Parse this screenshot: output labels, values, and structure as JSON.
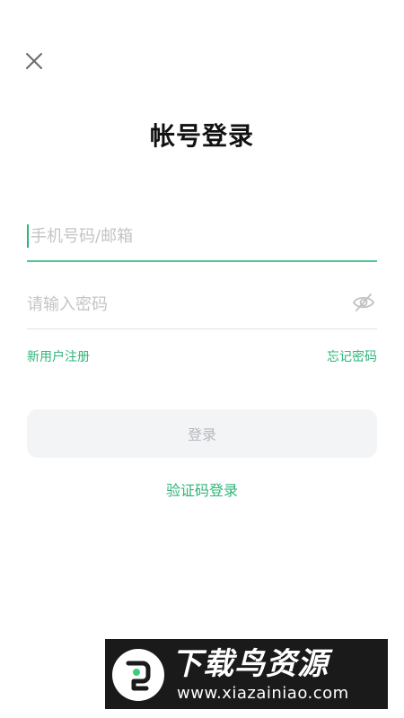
{
  "page": {
    "title": "帐号登录",
    "account_placeholder": "手机号码/邮箱",
    "password_placeholder": "请输入密码",
    "register_link": "新用户注册",
    "forgot_link": "忘记密码",
    "login_button": "登录",
    "code_login_link": "验证码登录"
  },
  "icons": {
    "close": "close-icon",
    "eye": "eye-hidden-icon"
  },
  "watermark": {
    "title": "下载鸟资源",
    "url": "www.xiazainiao.com"
  },
  "colors": {
    "accent": "#2fb47a",
    "input_active_underline": "#4cc58f",
    "button_bg": "#f3f4f6",
    "button_text": "#b7b9bd",
    "placeholder": "#c4c4c4"
  }
}
